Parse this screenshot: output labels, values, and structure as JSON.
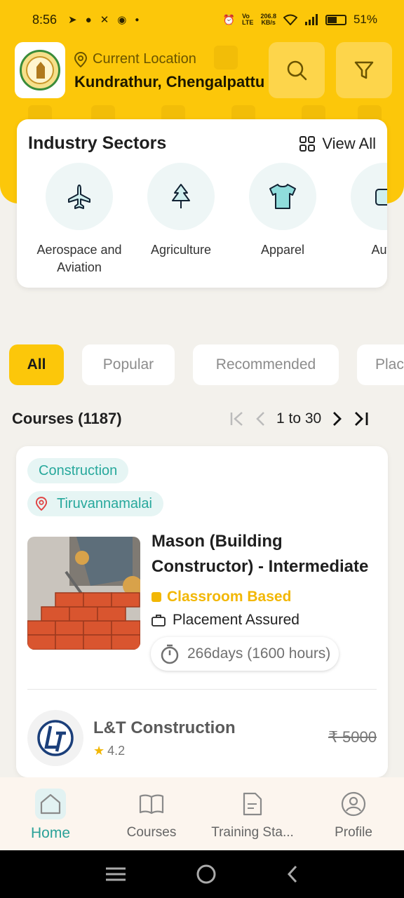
{
  "status_bar": {
    "time": "8:56",
    "net_speed_value": "206.8",
    "net_speed_unit": "KB/s",
    "battery": "51%"
  },
  "header": {
    "logo_icon": "tn-government-seal",
    "location_label": "Current Location",
    "location_value": "Kundrathur, Chengalpattu",
    "search_icon": "search-icon",
    "filter_icon": "filter-icon"
  },
  "industry_sectors": {
    "title": "Industry Sectors",
    "view_all": "View All",
    "items": [
      {
        "label": "Aerospace and Aviation",
        "icon": "airplane-icon"
      },
      {
        "label": "Agriculture",
        "icon": "tree-icon"
      },
      {
        "label": "Apparel",
        "icon": "tshirt-icon"
      },
      {
        "label": "Auto",
        "icon": "automotive-icon"
      }
    ]
  },
  "filters": {
    "chips": [
      "All",
      "Popular",
      "Recommended",
      "Plac"
    ],
    "selected": "All"
  },
  "courses": {
    "count_label": "Courses (1187)",
    "pagination": "1 to 30",
    "card": {
      "sector": "Construction",
      "location": "Tiruvannamalai",
      "title": "Mason (Building Constructor) - Intermediate",
      "mode": "Classroom Based",
      "placement": "Placement Assured",
      "duration": "266days (1600 hours)",
      "provider": "L&T Construction",
      "rating": "4.2",
      "price": "₹ 5000"
    }
  },
  "bottom_nav": {
    "items": [
      {
        "label": "Home",
        "icon": "home-icon"
      },
      {
        "label": "Courses",
        "icon": "book-icon"
      },
      {
        "label": "Training Sta...",
        "icon": "document-icon"
      },
      {
        "label": "Profile",
        "icon": "profile-icon"
      }
    ],
    "active": "Home"
  },
  "colors": {
    "accent": "#fcc70a",
    "teal": "#2aa198",
    "mode_yellow": "#f2b705"
  }
}
